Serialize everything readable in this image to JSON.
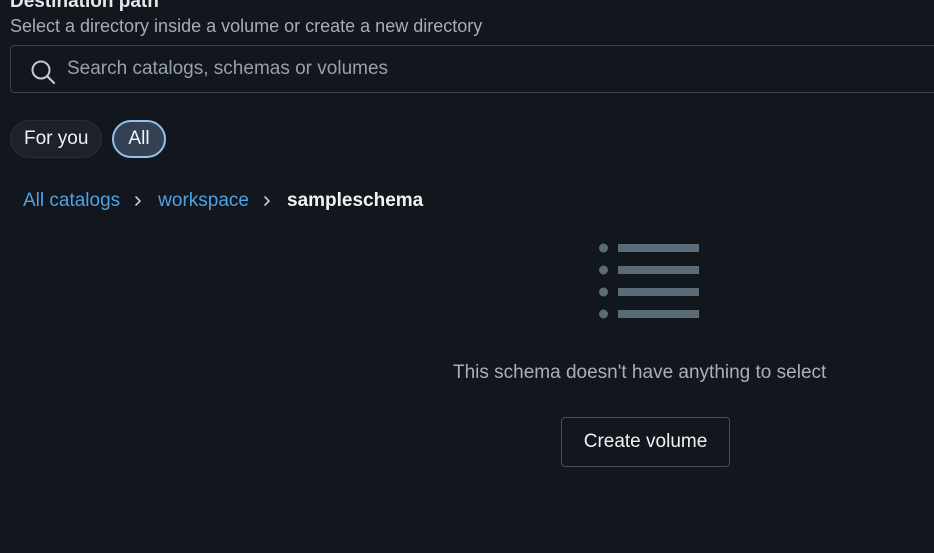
{
  "destination": {
    "label": "Destination path",
    "hint": "Select a directory inside a volume or create a new directory"
  },
  "search": {
    "placeholder": "Search catalogs, schemas or volumes",
    "icon": "search-icon"
  },
  "tabs": [
    {
      "label": "For you",
      "selected": false
    },
    {
      "label": "All",
      "selected": true
    }
  ],
  "breadcrumb": {
    "items": [
      {
        "label": "All catalogs",
        "link": true
      },
      {
        "label": "workspace",
        "link": true
      },
      {
        "label": "sampleschema",
        "link": false
      }
    ],
    "separator_icon": "chevron-right-icon"
  },
  "empty_state": {
    "icon": "list-icon",
    "message": "This schema doesn't have anything to select",
    "button_label": "Create volume"
  },
  "colors": {
    "background": "#12161d",
    "link": "#4ea3e3",
    "selected_tab_border": "#8ec2f0",
    "empty_icon": "#5c6b78"
  }
}
